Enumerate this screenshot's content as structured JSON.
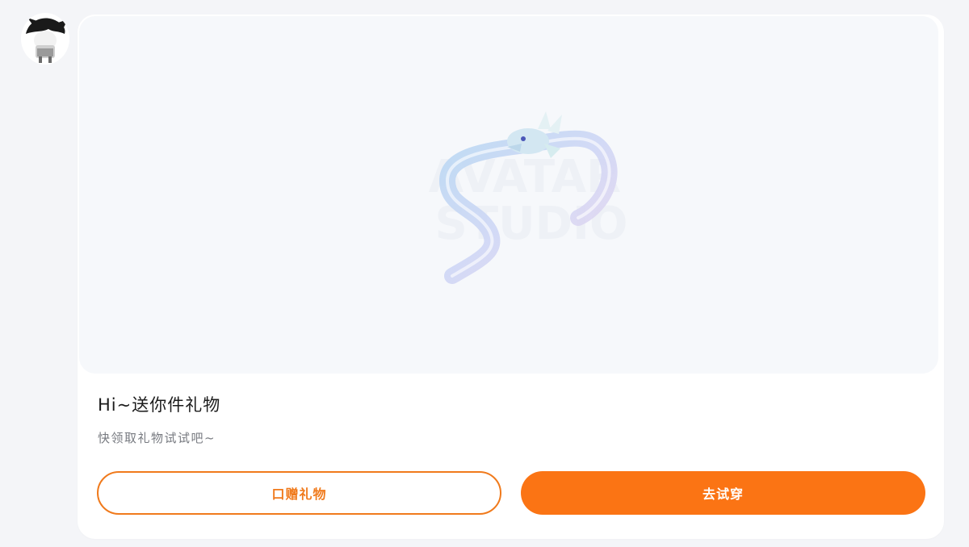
{
  "avatar": {
    "icon": "user-avatar-icon"
  },
  "preview": {
    "icon": "dragon-outfit-icon",
    "watermark_lines": [
      "AVATAR",
      "STUDIO"
    ]
  },
  "gift": {
    "title": "Hi~送你件礼物",
    "subtitle": "快领取礼物试试吧~"
  },
  "buttons": {
    "gift_label": "口赠礼物",
    "try_label": "去试穿"
  },
  "colors": {
    "accent": "#fb7414",
    "accent_outline": "#f07a1c",
    "background": "#f4f5f8",
    "card": "#ffffff",
    "preview_bg": "#f6f8fb"
  }
}
